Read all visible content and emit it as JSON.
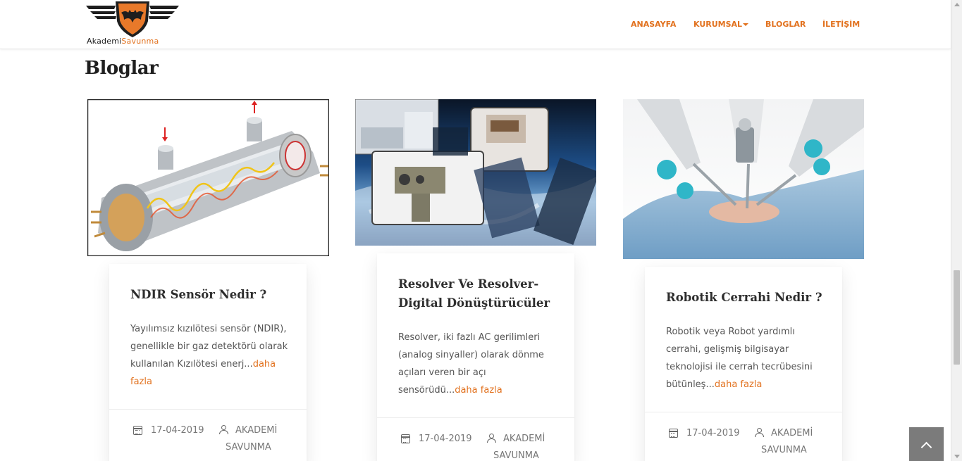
{
  "header": {
    "logo": {
      "part1": "Akademi",
      "part2": "Savunma"
    },
    "nav": [
      {
        "label": "ANASAYFA"
      },
      {
        "label": "KURUMSAL"
      },
      {
        "label": "BLOGLAR"
      },
      {
        "label": "İLETİŞİM"
      }
    ]
  },
  "page_title": "Bloglar",
  "posts": [
    {
      "title": "NDIR Sensör Nedir ?",
      "excerpt": "Yayılımsız kızılötesi sensör (NDIR), genellikle bir gaz detektörü olarak kullanılan Kızılötesi enerj...",
      "more": "daha fazla",
      "date": "17-04-2019",
      "author": "AKADEMİ SAVUNMA"
    },
    {
      "title": "Resolver Ve Resolver-Digital Dönüştürücüler",
      "excerpt": "Resolver, iki fazlı AC gerilimleri  (analog sinyaller)  olarak dönme açıları veren bir açı sensörüdü...",
      "more": "daha fazla",
      "date": "17-04-2019",
      "author": "AKADEMİ SAVUNMA"
    },
    {
      "title": "Robotik Cerrahi Nedir ?",
      "excerpt": "Robotik veya Robot yardımlı cerrahi, gelişmiş bilgisayar teknolojisi ile cerrah tecrübesini bütünleş...",
      "more": "daha fazla",
      "date": "17-04-2019",
      "author": "AKADEMİ SAVUNMA"
    }
  ],
  "colors": {
    "accent": "#e2721f",
    "title": "#2d2d2d",
    "text": "#555555"
  },
  "icons": [
    "calendar-icon",
    "user-icon",
    "chevron-up-icon",
    "caret-down-icon"
  ]
}
